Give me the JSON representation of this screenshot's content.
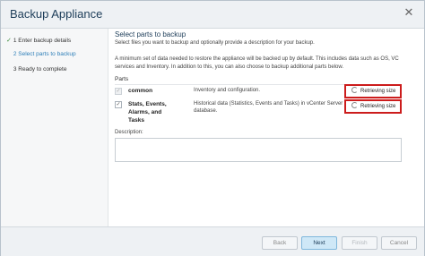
{
  "window": {
    "title": "Backup Appliance"
  },
  "steps": [
    {
      "number": "1",
      "label": "Enter backup details",
      "state": "completed"
    },
    {
      "number": "2",
      "label": "Select parts to backup",
      "state": "active"
    },
    {
      "number": "3",
      "label": "Ready to complete",
      "state": "pending"
    }
  ],
  "main": {
    "title": "Select parts to backup",
    "subtitle": "Select files you want to backup and optionally provide a description for your backup.",
    "intro": "A minimum set of data needed to restore the appliance will be backed up by default. This includes data such as OS, VC services and Inventory. In addition to this, you can also choose to backup additional parts below.",
    "parts_heading": "Parts",
    "parts": [
      {
        "name": "common",
        "description": "Inventory and configuration.",
        "size": "Retrieving size",
        "checked": true,
        "disabled": true
      },
      {
        "name": "Stats, Events, Alarms, and Tasks",
        "description": "Historical data (Statistics, Events and Tasks) in vCenter Server database.",
        "size": "Retrieving size",
        "checked": true,
        "disabled": false
      }
    ],
    "description_label": "Description:",
    "description_value": ""
  },
  "footer": {
    "back": "Back",
    "next": "Next",
    "finish": "Finish",
    "cancel": "Cancel"
  },
  "colors": {
    "highlight": "#cc1c1c",
    "active_step": "#2e7fb8",
    "next_button": "#cfe8f7"
  }
}
